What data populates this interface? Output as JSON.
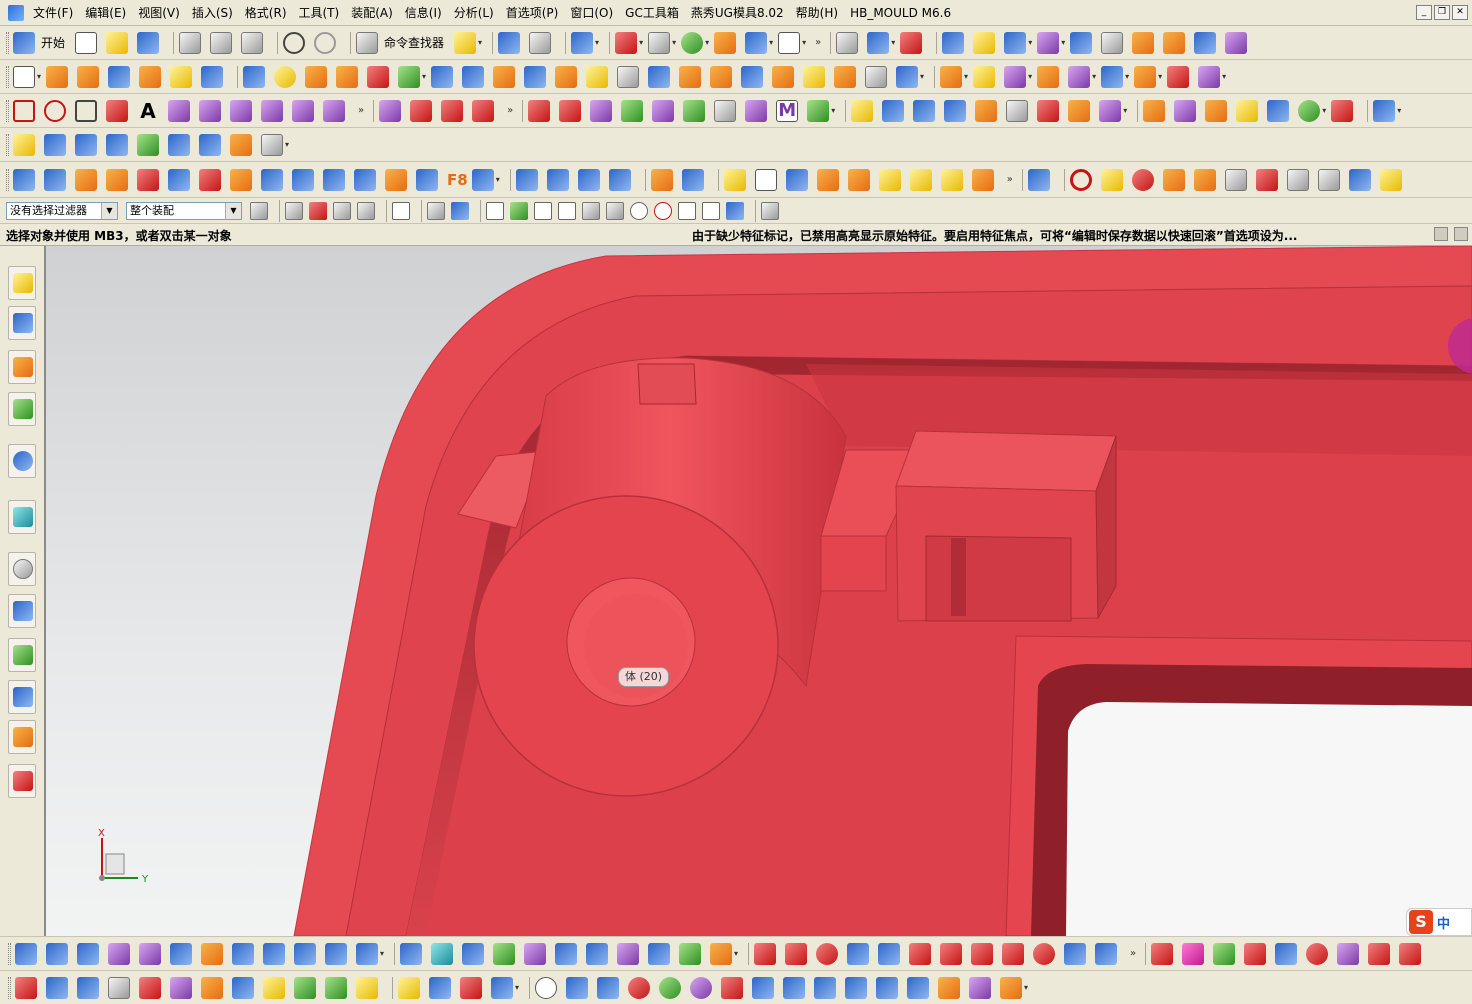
{
  "menu": {
    "items": [
      "文件(F)",
      "编辑(E)",
      "视图(V)",
      "插入(S)",
      "格式(R)",
      "工具(T)",
      "装配(A)",
      "信息(I)",
      "分析(L)",
      "首选项(P)",
      "窗口(O)",
      "GC工具箱",
      "燕秀UG模具8.02",
      "帮助(H)",
      "HB_MOULD M6.6"
    ]
  },
  "toolbar": {
    "start_label": "开始",
    "command_finder_label": "命令查找器",
    "f8_label": "F8"
  },
  "filterbar": {
    "selection_filter": "没有选择过滤器",
    "assembly_scope": "整个装配"
  },
  "status": {
    "left": "选择对象并使用 MB3，或者双击某一对象",
    "right": "由于缺少特征标记，已禁用高亮显示原始特征。要启用特征焦点，可将“编辑时保存数据以快速回滚”首选项设为..."
  },
  "viewport": {
    "tooltip": "体 (20)",
    "model_color": "#e5454f",
    "triad": {
      "x_label": "X",
      "y_label": "Y"
    }
  },
  "ime": {
    "logo": "S",
    "mode": "中"
  },
  "colors": {
    "toolbar_bg": "#ece9d8",
    "model": "#e5454f",
    "model_shadow": "#b8303a",
    "viewport_bg": "#cfd1d3"
  }
}
